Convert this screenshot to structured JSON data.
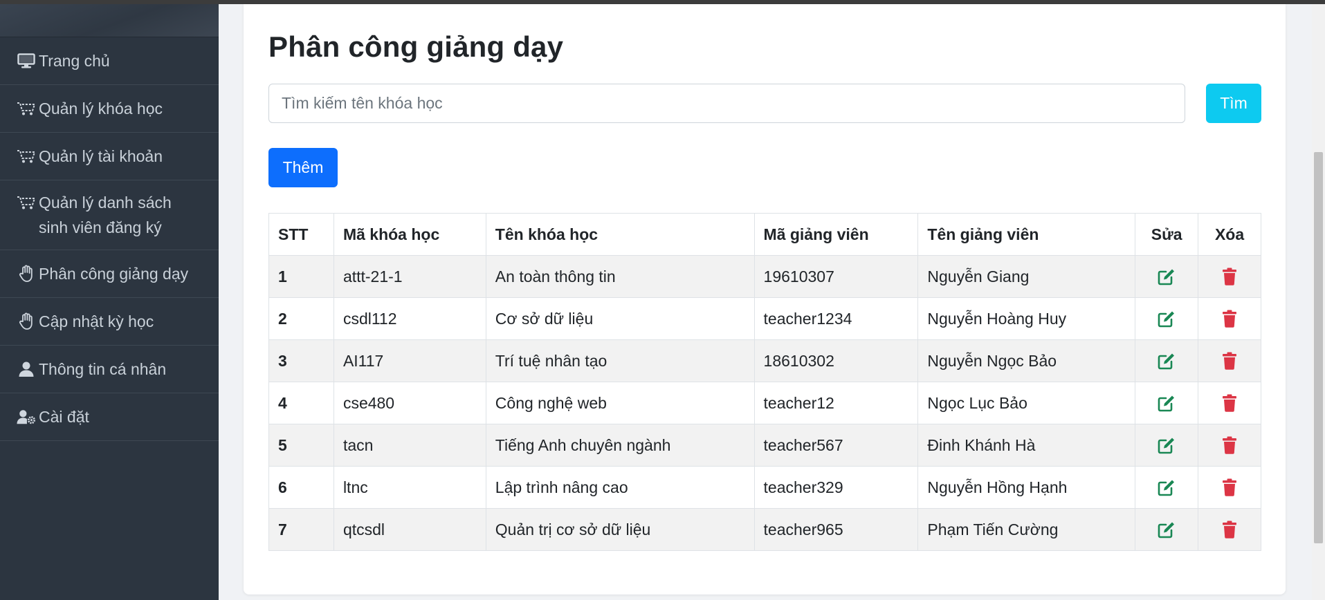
{
  "sidebar": {
    "items": [
      {
        "label": "Trang chủ",
        "icon": "desktop-icon"
      },
      {
        "label": "Quản lý khóa học",
        "icon": "cart-icon"
      },
      {
        "label": "Quản lý tài khoản",
        "icon": "cart-icon"
      },
      {
        "label": "Quản lý danh sách sinh viên đăng ký",
        "icon": "cart-icon"
      },
      {
        "label": "Phân công giảng dạy",
        "icon": "hand-icon"
      },
      {
        "label": "Cập nhật kỳ học",
        "icon": "hand-icon"
      },
      {
        "label": "Thông tin cá nhân",
        "icon": "user-icon"
      },
      {
        "label": "Cài đặt",
        "icon": "user-gear-icon"
      }
    ]
  },
  "main": {
    "title": "Phân công giảng dạy",
    "search": {
      "placeholder": "Tìm kiếm tên khóa học",
      "value": "",
      "button_label": "Tìm"
    },
    "add_button_label": "Thêm"
  },
  "table": {
    "headers": [
      "STT",
      "Mã khóa học",
      "Tên khóa học",
      "Mã giảng viên",
      "Tên giảng viên",
      "Sửa",
      "Xóa"
    ],
    "rows": [
      {
        "stt": "1",
        "course_code": "attt-21-1",
        "course_name": "An toàn thông tin",
        "teacher_code": "19610307",
        "teacher_name": "Nguyễn Giang"
      },
      {
        "stt": "2",
        "course_code": "csdl112",
        "course_name": "Cơ sở dữ liệu",
        "teacher_code": "teacher1234",
        "teacher_name": "Nguyễn Hoàng Huy"
      },
      {
        "stt": "3",
        "course_code": "AI117",
        "course_name": "Trí tuệ nhân tạo",
        "teacher_code": "18610302",
        "teacher_name": "Nguyễn Ngọc Bảo"
      },
      {
        "stt": "4",
        "course_code": "cse480",
        "course_name": "Công nghệ web",
        "teacher_code": "teacher12",
        "teacher_name": "Ngọc Lục Bảo"
      },
      {
        "stt": "5",
        "course_code": "tacn",
        "course_name": "Tiếng Anh chuyên ngành",
        "teacher_code": "teacher567",
        "teacher_name": "Đinh Khánh Hà"
      },
      {
        "stt": "6",
        "course_code": "ltnc",
        "course_name": "Lập trình nâng cao",
        "teacher_code": "teacher329",
        "teacher_name": "Nguyễn Hồng Hạnh"
      },
      {
        "stt": "7",
        "course_code": "qtcsdl",
        "course_name": "Quản trị cơ sở dữ liệu",
        "teacher_code": "teacher965",
        "teacher_name": "Phạm Tiến Cường"
      }
    ]
  },
  "colors": {
    "sidebar_bg": "#2c3540",
    "primary": "#0d6efd",
    "info": "#0dcaf0",
    "edit_icon": "#198754",
    "delete_icon": "#dc3545"
  }
}
